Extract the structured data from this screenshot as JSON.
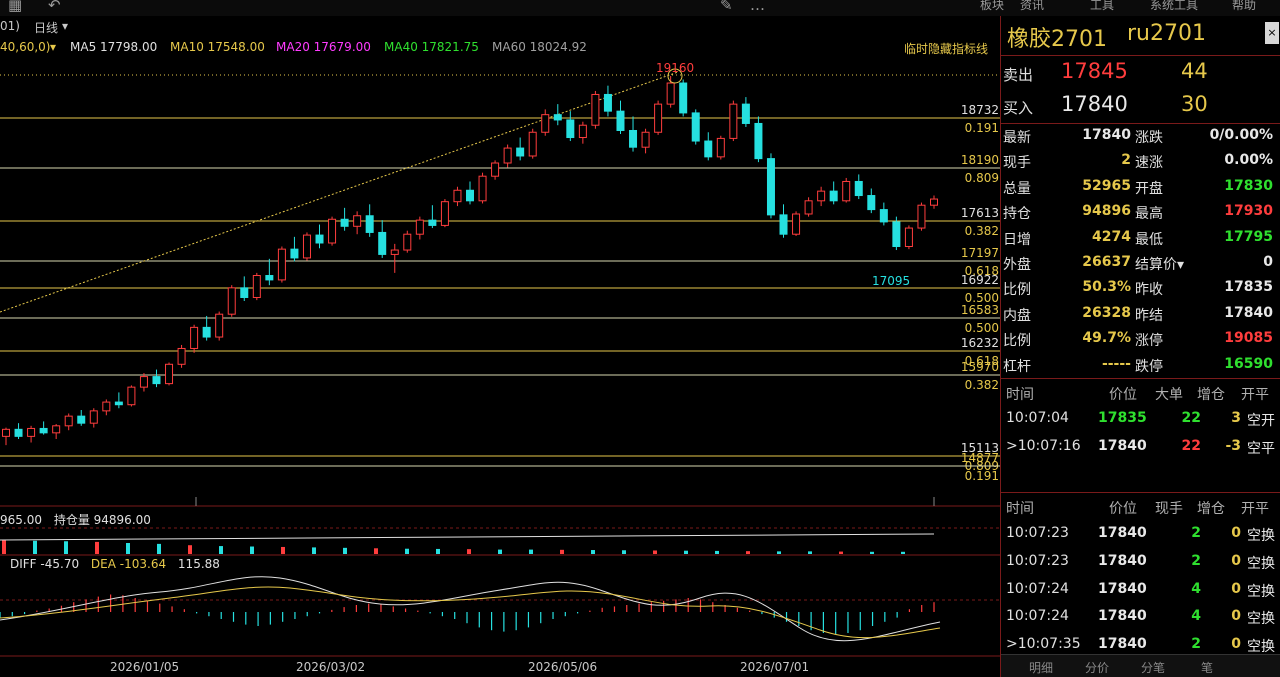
{
  "toolbar": {
    "icons": [
      "grid-icon",
      "back-icon",
      "draw-icon",
      "period-icon",
      "order-icon"
    ],
    "menus": [
      "板块",
      "资讯",
      "工具",
      "系统工具",
      "帮助"
    ]
  },
  "period_bar": {
    "left_fragment": "01)",
    "period_label": "日线",
    "period_caret": "▾"
  },
  "ma_bar": {
    "params": "40,60,0)",
    "caret": "▾",
    "ma5": "MA5 17798.00",
    "ma10": "MA10 17548.00",
    "ma20": "MA20 17679.00",
    "ma40": "MA40 17821.75",
    "ma60": "MA60 18024.92",
    "hide_indicator": "临时隐藏指标线"
  },
  "colors": {
    "up": "#ff3d3d",
    "down": "#26e0e0",
    "ma5": "#e0e0e0",
    "ma10": "#e6c84b",
    "ma20": "#ff3cff",
    "ma40": "#2fe02f",
    "ma60": "#a0a0a0",
    "fib": "#e6c84b"
  },
  "chart": {
    "high_label": "19160",
    "low_label": "17095",
    "fib_levels": [
      {
        "price": "18732",
        "ratio": "0.191"
      },
      {
        "price": "18190",
        "ratio": "0.809"
      },
      {
        "price": "17613",
        "ratio": "0.382"
      },
      {
        "price": "17197",
        "ratio": "0.618"
      },
      {
        "price": "16922",
        "ratio": "0.500"
      },
      {
        "price": "16583",
        "ratio": "0.500"
      },
      {
        "price": "16232",
        "ratio": "0.618"
      },
      {
        "price": "15970",
        "ratio": "0.382"
      },
      {
        "price": "15113",
        "ratio": "0.809"
      },
      {
        "price": "14877",
        "ratio": "0.191"
      }
    ],
    "dates": [
      "2026/01/05",
      "2026/03/02",
      "2026/05/06",
      "2026/07/01"
    ],
    "candles": [
      [
        15060,
        15160,
        14960,
        15140
      ],
      [
        15140,
        15210,
        15030,
        15060
      ],
      [
        15060,
        15180,
        14990,
        15150
      ],
      [
        15150,
        15230,
        15080,
        15100
      ],
      [
        15100,
        15200,
        15030,
        15180
      ],
      [
        15180,
        15320,
        15130,
        15290
      ],
      [
        15290,
        15360,
        15180,
        15210
      ],
      [
        15210,
        15380,
        15160,
        15350
      ],
      [
        15350,
        15480,
        15300,
        15450
      ],
      [
        15450,
        15560,
        15380,
        15420
      ],
      [
        15420,
        15640,
        15400,
        15620
      ],
      [
        15620,
        15780,
        15570,
        15740
      ],
      [
        15740,
        15820,
        15620,
        15660
      ],
      [
        15660,
        15900,
        15640,
        15880
      ],
      [
        15880,
        16100,
        15840,
        16060
      ],
      [
        16060,
        16330,
        16010,
        16300
      ],
      [
        16300,
        16430,
        16150,
        16190
      ],
      [
        16190,
        16480,
        16150,
        16450
      ],
      [
        16450,
        16780,
        16420,
        16750
      ],
      [
        16750,
        16880,
        16600,
        16640
      ],
      [
        16640,
        16920,
        16610,
        16890
      ],
      [
        16890,
        17080,
        16780,
        16840
      ],
      [
        16840,
        17220,
        16810,
        17190
      ],
      [
        17190,
        17330,
        17050,
        17090
      ],
      [
        17090,
        17380,
        17060,
        17350
      ],
      [
        17350,
        17470,
        17200,
        17260
      ],
      [
        17260,
        17560,
        17230,
        17530
      ],
      [
        17530,
        17660,
        17400,
        17450
      ],
      [
        17450,
        17620,
        17360,
        17570
      ],
      [
        17570,
        17700,
        17330,
        17380
      ],
      [
        17380,
        17520,
        17090,
        17130
      ],
      [
        17130,
        17250,
        16920,
        17180
      ],
      [
        17180,
        17400,
        17150,
        17360
      ],
      [
        17360,
        17560,
        17300,
        17520
      ],
      [
        17520,
        17690,
        17430,
        17460
      ],
      [
        17460,
        17760,
        17440,
        17730
      ],
      [
        17730,
        17900,
        17680,
        17860
      ],
      [
        17860,
        17960,
        17700,
        17740
      ],
      [
        17740,
        18060,
        17710,
        18020
      ],
      [
        18020,
        18200,
        17980,
        18170
      ],
      [
        18170,
        18380,
        18120,
        18340
      ],
      [
        18340,
        18460,
        18200,
        18250
      ],
      [
        18250,
        18560,
        18220,
        18520
      ],
      [
        18520,
        18780,
        18480,
        18720
      ],
      [
        18720,
        18840,
        18600,
        18660
      ],
      [
        18660,
        18760,
        18420,
        18460
      ],
      [
        18460,
        18640,
        18390,
        18600
      ],
      [
        18600,
        18990,
        18560,
        18950
      ],
      [
        18950,
        19050,
        18700,
        18760
      ],
      [
        18760,
        18880,
        18500,
        18540
      ],
      [
        18540,
        18700,
        18300,
        18350
      ],
      [
        18350,
        18560,
        18280,
        18520
      ],
      [
        18520,
        18880,
        18490,
        18840
      ],
      [
        18840,
        19160,
        18800,
        19080
      ],
      [
        19080,
        19120,
        18700,
        18740
      ],
      [
        18740,
        18780,
        18380,
        18420
      ],
      [
        18420,
        18520,
        18200,
        18240
      ],
      [
        18240,
        18480,
        18210,
        18450
      ],
      [
        18450,
        18880,
        18420,
        18840
      ],
      [
        18840,
        18920,
        18580,
        18620
      ],
      [
        18620,
        18700,
        18180,
        18220
      ],
      [
        18220,
        18280,
        17540,
        17580
      ],
      [
        17580,
        17700,
        17320,
        17360
      ],
      [
        17360,
        17620,
        17340,
        17590
      ],
      [
        17590,
        17780,
        17560,
        17740
      ],
      [
        17740,
        17900,
        17680,
        17850
      ],
      [
        17850,
        17960,
        17700,
        17740
      ],
      [
        17740,
        18000,
        17720,
        17960
      ],
      [
        17960,
        18040,
        17760,
        17800
      ],
      [
        17800,
        17880,
        17600,
        17640
      ],
      [
        17640,
        17720,
        17460,
        17500
      ],
      [
        17500,
        17560,
        17180,
        17220
      ],
      [
        17220,
        17460,
        17190,
        17430
      ],
      [
        17430,
        17720,
        17400,
        17690
      ],
      [
        17690,
        17800,
        17650,
        17760
      ]
    ],
    "volume_bars": [
      62,
      60,
      58,
      55,
      50,
      46,
      40,
      36,
      34,
      32,
      30,
      28,
      26,
      24,
      23,
      22,
      20,
      20,
      19,
      18,
      17,
      16,
      15,
      14,
      13,
      12,
      12,
      11,
      10,
      10
    ],
    "macd_bars": [
      -8,
      -6,
      -3,
      2,
      5,
      9,
      14,
      18,
      22,
      25,
      24,
      20,
      16,
      12,
      8,
      4,
      -2,
      -6,
      -10,
      -14,
      -18,
      -20,
      -18,
      -14,
      -10,
      -6,
      -2,
      3,
      7,
      10,
      12,
      11,
      8,
      5,
      2,
      -2,
      -6,
      -10,
      -16,
      -22,
      -26,
      -28,
      -26,
      -22,
      -16,
      -10,
      -6,
      -2,
      2,
      6,
      8,
      10,
      12,
      14,
      16,
      18,
      20,
      18,
      14,
      10,
      6,
      2,
      -3,
      -8,
      -14,
      -20,
      -26,
      -30,
      -32,
      -30,
      -26,
      -20,
      -14,
      -8,
      4,
      10,
      14
    ]
  },
  "volume_panel": {
    "total_volume": "965.00",
    "open_interest": "持仓量 94896.00"
  },
  "macd_panel": {
    "diff": "DIFF -45.70",
    "dea": "DEA -103.64",
    "macd": "115.88"
  },
  "quote": {
    "name": "橡胶2701",
    "code": "ru2701",
    "close_icon": "×",
    "ask": {
      "label": "卖出",
      "price": "17845",
      "volume": "44"
    },
    "bid": {
      "label": "买入",
      "price": "17840",
      "volume": "30"
    },
    "rows": [
      {
        "l1": "最新",
        "v1": "17840",
        "c1": "white",
        "l2": "涨跌",
        "v2": "0/0.00%",
        "c2": "white"
      },
      {
        "l1": "现手",
        "v1": "2",
        "c1": "yellow",
        "l2": "速涨",
        "v2": "0.00%",
        "c2": "white"
      },
      {
        "l1": "总量",
        "v1": "52965",
        "c1": "yellow",
        "l2": "开盘",
        "v2": "17830",
        "c2": "green"
      },
      {
        "l1": "持仓",
        "v1": "94896",
        "c1": "yellow",
        "l2": "最高",
        "v2": "17930",
        "c2": "red"
      },
      {
        "l1": "日增",
        "v1": "4274",
        "c1": "yellow",
        "l2": "最低",
        "v2": "17795",
        "c2": "green"
      },
      {
        "l1": "外盘",
        "v1": "26637",
        "c1": "yellow",
        "l2": "结算价▾",
        "v2": "0",
        "c2": "white"
      },
      {
        "l1": "比例",
        "v1": "50.3%",
        "c1": "yellow",
        "l2": "昨收",
        "v2": "17835",
        "c2": "white"
      },
      {
        "l1": "内盘",
        "v1": "26328",
        "c1": "yellow",
        "l2": "昨结",
        "v2": "17840",
        "c2": "white"
      },
      {
        "l1": "比例",
        "v1": "49.7%",
        "c1": "yellow",
        "l2": "涨停",
        "v2": "19085",
        "c2": "red"
      },
      {
        "l1": "杠杆",
        "v1": "-----",
        "c1": "yellow",
        "l2": "跌停",
        "v2": "16590",
        "c2": "green"
      }
    ]
  },
  "big_orders": {
    "headers": [
      "时间",
      "价位",
      "大单",
      "增仓",
      "开平"
    ],
    "rows": [
      {
        "time": "10:07:04",
        "price": "17835",
        "pc": "green",
        "vol": "22",
        "vc": "green",
        "chg": "3",
        "type": "空开"
      },
      {
        "time": ">10:07:16",
        "price": "17840",
        "pc": "white",
        "vol": "22",
        "vc": "red",
        "chg": "-3",
        "type": "空平"
      }
    ]
  },
  "ticks": {
    "headers": [
      "时间",
      "价位",
      "现手",
      "增仓",
      "开平"
    ],
    "rows": [
      {
        "time": "10:07:23",
        "price": "17840",
        "vol": "2",
        "chg": "0",
        "type": "空换"
      },
      {
        "time": "10:07:23",
        "price": "17840",
        "vol": "2",
        "chg": "0",
        "type": "空换"
      },
      {
        "time": "10:07:24",
        "price": "17840",
        "vol": "4",
        "chg": "0",
        "type": "空换"
      },
      {
        "time": "10:07:24",
        "price": "17840",
        "vol": "4",
        "chg": "0",
        "type": "空换"
      },
      {
        "time": ">10:07:35",
        "price": "17840",
        "vol": "2",
        "chg": "0",
        "type": "空换"
      }
    ]
  },
  "bottom_tabs": [
    "明细",
    "分价",
    "分笔",
    "笔"
  ]
}
